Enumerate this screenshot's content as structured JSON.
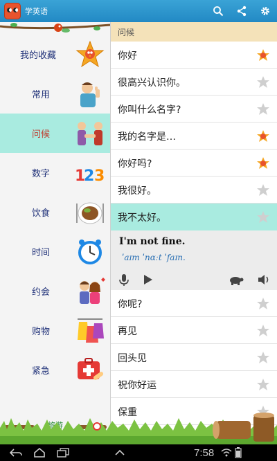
{
  "app": {
    "title": "学英语"
  },
  "sidebar": {
    "categories": [
      {
        "label": "我的收藏",
        "icon": "favorites-rooster-star-icon",
        "selected": false
      },
      {
        "label": "常用",
        "icon": "man-thumbs-up-icon",
        "selected": false
      },
      {
        "label": "问候",
        "icon": "handshake-greeting-icon",
        "selected": true
      },
      {
        "label": "数字",
        "icon": "numbers-123-icon",
        "selected": false
      },
      {
        "label": "饮食",
        "icon": "food-plate-icon",
        "selected": false
      },
      {
        "label": "时间",
        "icon": "alarm-clock-icon",
        "selected": false
      },
      {
        "label": "约会",
        "icon": "couple-date-icon",
        "selected": false
      },
      {
        "label": "购物",
        "icon": "shopping-bags-icon",
        "selected": false
      },
      {
        "label": "紧急",
        "icon": "first-aid-kit-icon",
        "selected": false
      }
    ],
    "bottom_label": "旅游"
  },
  "list": {
    "section_title": "问候",
    "phrases": [
      {
        "text": "你好",
        "favorite": true
      },
      {
        "text": "很高兴认识你。",
        "favorite": false
      },
      {
        "text": "你叫什么名字?",
        "favorite": false
      },
      {
        "text": "我的名字是…",
        "favorite": true
      },
      {
        "text": "你好吗?",
        "favorite": true
      },
      {
        "text": "我很好。",
        "favorite": false
      },
      {
        "text": "我不太好。",
        "favorite": false,
        "selected": true
      },
      {
        "text": "你呢?",
        "favorite": false
      },
      {
        "text": "再见",
        "favorite": false
      },
      {
        "text": "回头见",
        "favorite": false
      },
      {
        "text": "祝你好运",
        "favorite": false
      },
      {
        "text": "保重",
        "favorite": false
      }
    ],
    "detail": {
      "english": "I'm not fine.",
      "phonetic": "ˈaɪm ˈnɑːt ˈfaɪn."
    }
  },
  "system_bar": {
    "time": "7:58"
  },
  "colors": {
    "action_bar": "#2289c4",
    "selected": "#a9ebe0",
    "section_header": "#f4e2b9",
    "category_text": "#22337a",
    "selected_category_text": "#c0392b"
  }
}
